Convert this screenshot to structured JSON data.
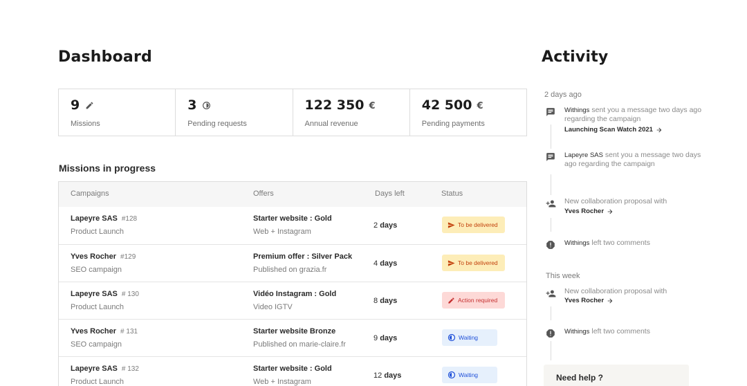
{
  "dashboard": {
    "title": "Dashboard",
    "stats": [
      {
        "value": "9",
        "label": "Missions",
        "icon": "pencil-icon"
      },
      {
        "value": "3",
        "label": "Pending requests",
        "icon": "progress-icon"
      },
      {
        "value": "122 350",
        "unit": "€",
        "label": "Annual revenue"
      },
      {
        "value": "42 500",
        "unit": "€",
        "label": "Pending payments"
      }
    ]
  },
  "missions": {
    "title": "Missions in progress",
    "columns": [
      "Campaigns",
      "Offers",
      "Days left",
      "Status"
    ],
    "rows": [
      {
        "client": "Lapeyre SAS",
        "id": "#128",
        "campaign": "Product Launch",
        "offer": "Starter website : Gold",
        "offer_detail": "Web + Instagram",
        "days_num": "2",
        "days_unit": "days",
        "status": "To be delivered",
        "status_type": "deliver"
      },
      {
        "client": "Yves Rocher",
        "id": "#129",
        "campaign": "SEO campaign",
        "offer": "Premium offer :  Silver Pack",
        "offer_detail": "Published on grazia.fr",
        "days_num": "4",
        "days_unit": "days",
        "status": "To be delivered",
        "status_type": "deliver"
      },
      {
        "client": "Lapeyre SAS",
        "id": "# 130",
        "campaign": "Product Launch",
        "offer": "Vidéo Instagram : Gold",
        "offer_detail": "Video IGTV",
        "days_num": "8",
        "days_unit": "days",
        "status": "Action required",
        "status_type": "action"
      },
      {
        "client": "Yves Rocher",
        "id": "# 131",
        "campaign": "SEO campaign",
        "offer": "Starter website Bronze",
        "offer_detail": "Published on marie-claire.fr",
        "days_num": "9",
        "days_unit": "days",
        "status": "Waiting",
        "status_type": "wait"
      },
      {
        "client": "Lapeyre SAS",
        "id": "# 132",
        "campaign": "Product Launch",
        "offer": "Starter website : Gold",
        "offer_detail": "Web + Instagram",
        "days_num": "12",
        "days_unit": "days",
        "status": "Waiting",
        "status_type": "wait"
      }
    ]
  },
  "activity": {
    "title": "Activity",
    "groups": [
      {
        "date": "2 days ago"
      },
      {
        "date": "This week"
      }
    ],
    "items": [
      {
        "who": "Withings",
        "text": " sent you a message two days ago regarding the campaign",
        "link": "Launching  Scan Watch 2021",
        "icon": "message-icon"
      },
      {
        "who": "Lapeyre SAS",
        "text": " sent you a message two days ago regarding the campaign",
        "icon": "message-icon"
      },
      {
        "text": "New collaboration proposal with",
        "link": "Yves Rocher",
        "icon": "add-user-icon"
      },
      {
        "who": "Withings",
        "text": " left two comments",
        "icon": "alert-icon"
      },
      {
        "text": "New collaboration proposal with",
        "link": "Yves Rocher",
        "icon": "add-user-icon"
      },
      {
        "who": "Withings",
        "text": " left two comments",
        "icon": "alert-icon"
      }
    ],
    "help": "Need help ?"
  },
  "colors": {
    "deliver_bg": "#fdedb8",
    "deliver_text": "#c2410c",
    "action_bg": "#fdd9d7",
    "action_text": "#c53030",
    "wait_bg": "#e6f0fc",
    "wait_text": "#1d4ed8"
  }
}
